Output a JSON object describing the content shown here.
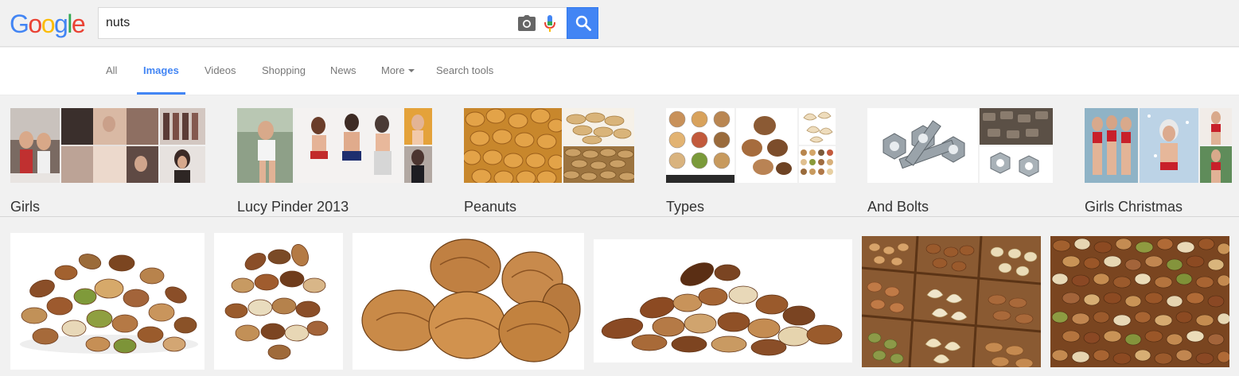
{
  "logo": {
    "letters": [
      "G",
      "o",
      "o",
      "g",
      "l",
      "e"
    ],
    "colors": [
      "#4285f4",
      "#ea4335",
      "#fbbc05",
      "#4285f4",
      "#34a853",
      "#ea4335"
    ]
  },
  "search": {
    "query": "nuts",
    "camera_icon": "camera-icon",
    "mic_icon": "mic-icon",
    "button_icon": "search-icon"
  },
  "colors": {
    "accent": "#4285f4",
    "button_border": "#3079ed",
    "header_bg": "#f1f1f1"
  },
  "tabs": [
    {
      "label": "All",
      "active": false
    },
    {
      "label": "Images",
      "active": true
    },
    {
      "label": "Videos",
      "active": false
    },
    {
      "label": "Shopping",
      "active": false
    },
    {
      "label": "News",
      "active": false
    },
    {
      "label": "More",
      "active": false
    },
    {
      "label": "Search tools",
      "active": false
    }
  ],
  "related": [
    {
      "label": "Girls"
    },
    {
      "label": "Lucy Pinder 2013"
    },
    {
      "label": "Peanuts"
    },
    {
      "label": "Types"
    },
    {
      "label": "And Bolts"
    },
    {
      "label": "Girls Christmas"
    }
  ],
  "results": [
    {
      "subject": "mixed nuts"
    },
    {
      "subject": "mixed nuts"
    },
    {
      "subject": "walnuts"
    },
    {
      "subject": "mixed nuts"
    },
    {
      "subject": "nuts in wooden tray"
    },
    {
      "subject": "mixed nuts close-up"
    }
  ]
}
